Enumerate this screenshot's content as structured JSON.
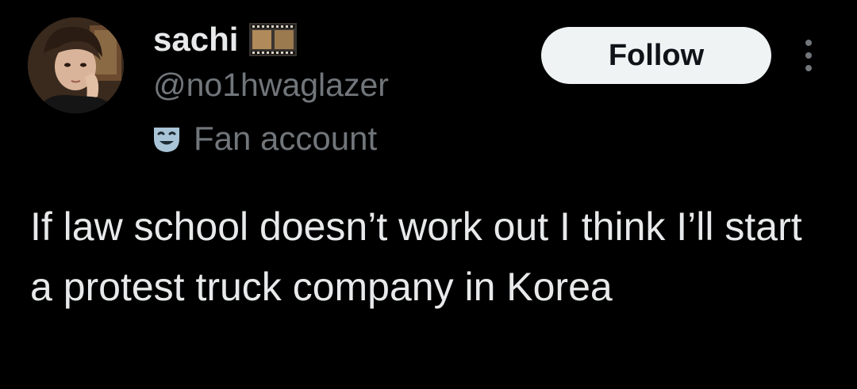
{
  "author": {
    "display_name": "sachi",
    "handle": "@no1hwaglazer",
    "affiliation_label": "Fan account",
    "display_name_emoji": "film-frames-icon",
    "affiliation_icon": "performing-arts-mask-icon"
  },
  "actions": {
    "follow_label": "Follow",
    "more_icon": "more-vertical-icon"
  },
  "tweet": {
    "text": "If law school doesn’t work out I think I’ll start a protest truck company in Korea"
  },
  "colors": {
    "background": "#000000",
    "primary_text": "#e7e9ea",
    "secondary_text": "#71767b",
    "follow_button_bg": "#eff3f4",
    "follow_button_text": "#0f1419"
  }
}
